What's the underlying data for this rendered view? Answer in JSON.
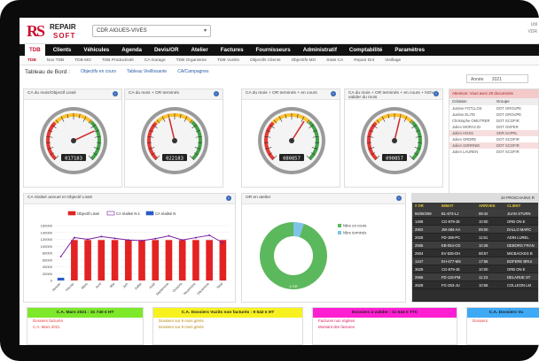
{
  "app": {
    "logo_letters": "RS",
    "logo_line1": "REPAIR",
    "logo_line2": "SOFT",
    "site": "CDR AIGUES-VIVES",
    "user_line1": "Util",
    "user_line2": "VDR"
  },
  "mainnav": [
    {
      "label": "TDB",
      "active": true
    },
    {
      "label": "Clients"
    },
    {
      "label": "Véhicules"
    },
    {
      "label": "Agenda"
    },
    {
      "label": "Devis/OR"
    },
    {
      "label": "Atelier"
    },
    {
      "label": "Factures"
    },
    {
      "label": "Fournisseurs"
    },
    {
      "label": "Administratif"
    },
    {
      "label": "Comptabilité"
    },
    {
      "label": "Paramètres"
    }
  ],
  "subnav": [
    "TDB",
    "Nov TDB",
    "TDB MO",
    "TDB Productivité",
    "CA Garage",
    "TDB Organisme",
    "TDB Vuzitis",
    "Objectifs Clients",
    "Objectifs MO",
    "Stats CA",
    "Repair Dnt",
    "Vieillage"
  ],
  "dashboard": {
    "title": "Tableau de Bord :",
    "links": [
      "Objectifs en cours",
      "Tableau Vieillissante",
      "CA/Campagnes"
    ],
    "year_label": "Année",
    "year_value": "2021"
  },
  "gauges": [
    {
      "title": "CA du mois/Objectif Lissé",
      "value": 74,
      "readout": "017183"
    },
    {
      "title": "CA du mois + OR terminés",
      "value": 45,
      "readout": "022183"
    },
    {
      "title": "CA du mois + OR terminés + en cours",
      "value": 62,
      "readout": "080857"
    },
    {
      "title": "CA du mois + OR terminés + en cours + NOV à valider du mois",
      "value": 55,
      "readout": "090857"
    }
  ],
  "side_panel": {
    "title": "Attention: Vous avez 20 documents",
    "columns": [
      "Création",
      "Groupe"
    ],
    "rows": [
      [
        "Justine FOTLLOS",
        "DOT GROUPE"
      ],
      [
        "Justine ELITE",
        "DOT GROUPE"
      ],
      [
        "Christophe OMUTRER",
        "DOT SCOFIR"
      ],
      [
        "Julien MORACIO",
        "DOT OSPER"
      ],
      [
        "Julien HOSS",
        "SDR SAPRL"
      ],
      [
        "Julien ORDRE",
        "DOT SCOFIR"
      ],
      [
        "Julien SORRNIE",
        "DOT SCOFIR"
      ],
      [
        "Julien LAUREN",
        "DOT SCOFIR"
      ]
    ]
  },
  "chart_card": {
    "title": "CA réalisé annuel et Objectif Lissé",
    "info": "i"
  },
  "chart_data": {
    "type": "bar",
    "categories": [
      "Janvier",
      "Février",
      "Mars",
      "Avril",
      "Mai",
      "Juin",
      "Juillet",
      "Août",
      "Septembre",
      "Octobre",
      "Novembre",
      "Décembre",
      "Total"
    ],
    "series": [
      {
        "name": "Objectif Lissé",
        "type": "bar",
        "color": "#e32222",
        "values": [
          0,
          118000,
          118000,
          118000,
          118000,
          118000,
          118000,
          118000,
          118000,
          118000,
          118000,
          118000,
          118000
        ]
      },
      {
        "name": "CA réalisé N-1",
        "type": "line",
        "color": "#7b1fa2",
        "values": [
          70000,
          125000,
          120000,
          128000,
          123000,
          118000,
          116000,
          122000,
          130000,
          118000,
          125000,
          132000,
          110000
        ]
      },
      {
        "name": "CA réalisé N",
        "type": "bar",
        "color": "#2a5cc8",
        "values": [
          8000,
          0,
          0,
          0,
          0,
          0,
          0,
          0,
          0,
          0,
          0,
          0,
          0
        ]
      }
    ],
    "yticks": [
      0,
      20000,
      40000,
      60000,
      80000,
      100000,
      120000,
      140000,
      160000
    ],
    "ylim": [
      0,
      160000
    ]
  },
  "donut_card": {
    "title": "OR en atelier",
    "info": "i",
    "legend": [
      "Nbre en cours",
      "Nbre terminés"
    ],
    "center_label": "4 OR",
    "values": [
      1,
      19
    ],
    "colors": [
      "#7fc3e8",
      "#5cb85c"
    ]
  },
  "table_card": {
    "title": "10 PROCHAINS R",
    "columns": [
      "# OR",
      "IMMAT",
      "ARRIVEE",
      "CLIENT"
    ],
    "rows": [
      [
        "55/06/259",
        "BL-673-LJ",
        "08:42",
        "JUAN STURN"
      ],
      [
        "1408",
        "CG-879-JE",
        "10:00",
        "ORB ON E"
      ],
      [
        "2902",
        "JW-484-AA",
        "09:00",
        "DALLO MARC"
      ],
      [
        "2628",
        "FD-186-PC",
        "11:51",
        "ADIN LUREL"
      ],
      [
        "2565",
        "EB-054-CD",
        "10:28",
        "DEBORG FRAN"
      ],
      [
        "2504",
        "EV-525-DH",
        "08:57",
        "MICBACKES B"
      ],
      [
        "1447",
        "EH-477-MS",
        "17:56",
        "BOFERE BRUI"
      ],
      [
        "3628",
        "CG-879-JE",
        "10:00",
        "ORB ON E"
      ],
      [
        "2665",
        "FD-115-PM",
        "11:23",
        "DELARUE ST"
      ],
      [
        "2628",
        "FG-253-JU",
        "10:56",
        "COLLEON LM"
      ]
    ]
  },
  "kpis": [
    {
      "title": "C.A. Mars 2021 : 31 740 € HT",
      "color": "#7ee82b",
      "lines": [
        "Dossiers facturés",
        "C.A. Mars 2021"
      ]
    },
    {
      "title": "C.A. Dossiers Vuzits non facturés : 9 542 € HT",
      "color": "#f7f21f",
      "lines": [
        "Dossiers sur 9 mois gérés",
        "Dossiers sur 9 mois gérés"
      ]
    },
    {
      "title": "Dossiers à valider : 11 644 € TTC",
      "color": "#ff1fd2",
      "lines": [
        "Factures non réglées",
        "Montant des factures"
      ]
    },
    {
      "title": "C.A. Dossiers Vu",
      "color": "#3fa9f5",
      "lines": [
        "Dossiers"
      ]
    }
  ]
}
